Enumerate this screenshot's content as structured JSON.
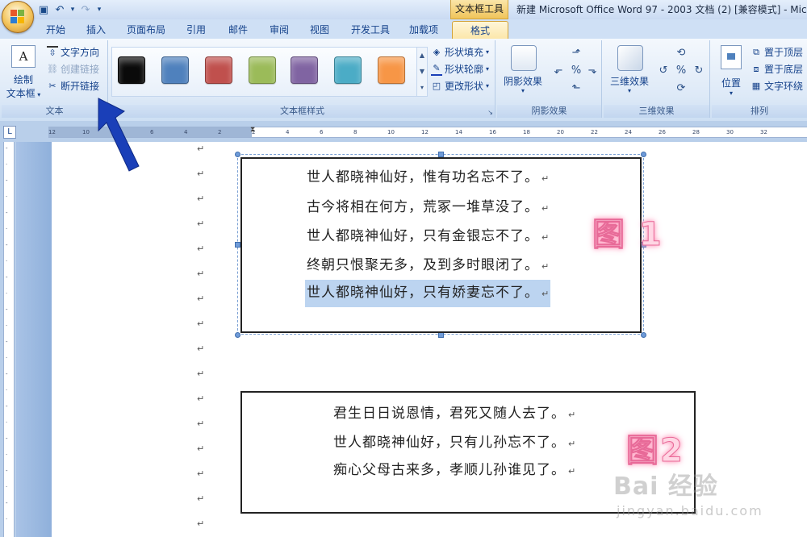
{
  "titlebar": {
    "context_group": "文本框工具",
    "window_title": "新建 Microsoft Office Word 97 - 2003 文档 (2) [兼容模式] - Micros",
    "qat": {
      "save": "save-icon",
      "undo": "undo-icon",
      "redo": "redo-icon",
      "more": "▾"
    }
  },
  "tabs": [
    {
      "label": "开始"
    },
    {
      "label": "插入"
    },
    {
      "label": "页面布局"
    },
    {
      "label": "引用"
    },
    {
      "label": "邮件"
    },
    {
      "label": "审阅"
    },
    {
      "label": "视图"
    },
    {
      "label": "开发工具"
    },
    {
      "label": "加载项"
    },
    {
      "label": "格式"
    }
  ],
  "ribbon": {
    "text_group": {
      "label": "文本",
      "draw_textbox_line1": "绘制",
      "draw_textbox_line2": "文本框",
      "text_direction": "文字方向",
      "create_link": "创建链接",
      "break_link": "断开链接"
    },
    "styles_group": {
      "label": "文本框样式",
      "swatches": [
        "#0a0a0a",
        "#4f81bd",
        "#c0504d",
        "#9bbb59",
        "#8064a2",
        "#4bacc6",
        "#f79646"
      ],
      "shape_fill": "形状填充",
      "shape_outline": "形状轮廓",
      "change_shape": "更改形状"
    },
    "shadow_group": {
      "label": "阴影效果",
      "button": "阴影效果"
    },
    "threed_group": {
      "label": "三维效果",
      "button": "三维效果"
    },
    "arrange_group": {
      "label": "排列",
      "position": "位置",
      "bring_front": "置于顶层",
      "send_back": "置于底层",
      "text_wrap": "文字环绕"
    }
  },
  "ruler": {
    "ticks": [
      "12",
      "10",
      "8",
      "6",
      "4",
      "2",
      "2",
      "4",
      "6",
      "8",
      "10",
      "12",
      "14",
      "16",
      "18",
      "20",
      "22",
      "24",
      "26",
      "28",
      "30",
      "32"
    ]
  },
  "document": {
    "textbox1": {
      "lines": [
        "世人都晓神仙好，惟有功名忘不了。",
        "古今将相在何方，荒冢一堆草没了。",
        "世人都晓神仙好，只有金银忘不了。",
        "终朝只恨聚无多，及到多时眼闭了。",
        "世人都晓神仙好，只有娇妻忘不了。"
      ],
      "label": "图 1"
    },
    "textbox2": {
      "lines": [
        "君生日日说恩情，君死又随人去了。",
        "世人都晓神仙好，只有儿孙忘不了。",
        "痴心父母古来多，孝顺儿孙谁见了。"
      ],
      "label": "图2"
    },
    "paragraph_mark": "↵"
  },
  "watermark": {
    "main": "Bai 经验",
    "sub": "jingyan.baidu.com"
  },
  "colors": {
    "pointer_arrow": "#1a3fb8",
    "highlight": "#bcd4f0",
    "label_glow": "#ff8fb6"
  }
}
